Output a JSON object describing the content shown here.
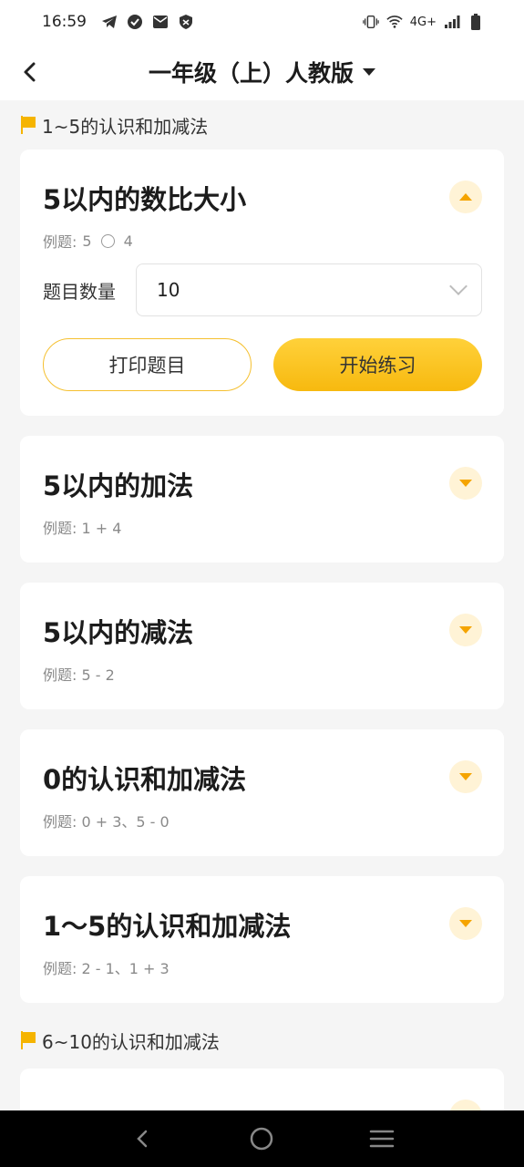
{
  "status": {
    "time": "16:59",
    "network": "4G+"
  },
  "header": {
    "title": "一年级（上）人教版"
  },
  "sections": [
    {
      "title": "1~5的认识和加减法",
      "cards": [
        {
          "title": "5以内的数比大小",
          "example_prefix": "例题:",
          "example_left": "5",
          "example_right": "4",
          "expanded": true,
          "qty_label": "题目数量",
          "qty_value": "10",
          "print_label": "打印题目",
          "start_label": "开始练习"
        },
        {
          "title": "5以内的加法",
          "example": "例题: 1 + 4"
        },
        {
          "title": "5以内的减法",
          "example": "例题: 5 - 2"
        },
        {
          "title": "0的认识和加减法",
          "example": "例题: 0 + 3、5 - 0"
        },
        {
          "title": "1～5的认识和加减法",
          "example": "例题: 2 - 1、1 + 3"
        }
      ]
    },
    {
      "title": "6~10的认识和加减法"
    }
  ],
  "colors": {
    "accent": "#f7b90f",
    "flag": "#f5b400",
    "toggle_bg": "#fff3d6"
  }
}
